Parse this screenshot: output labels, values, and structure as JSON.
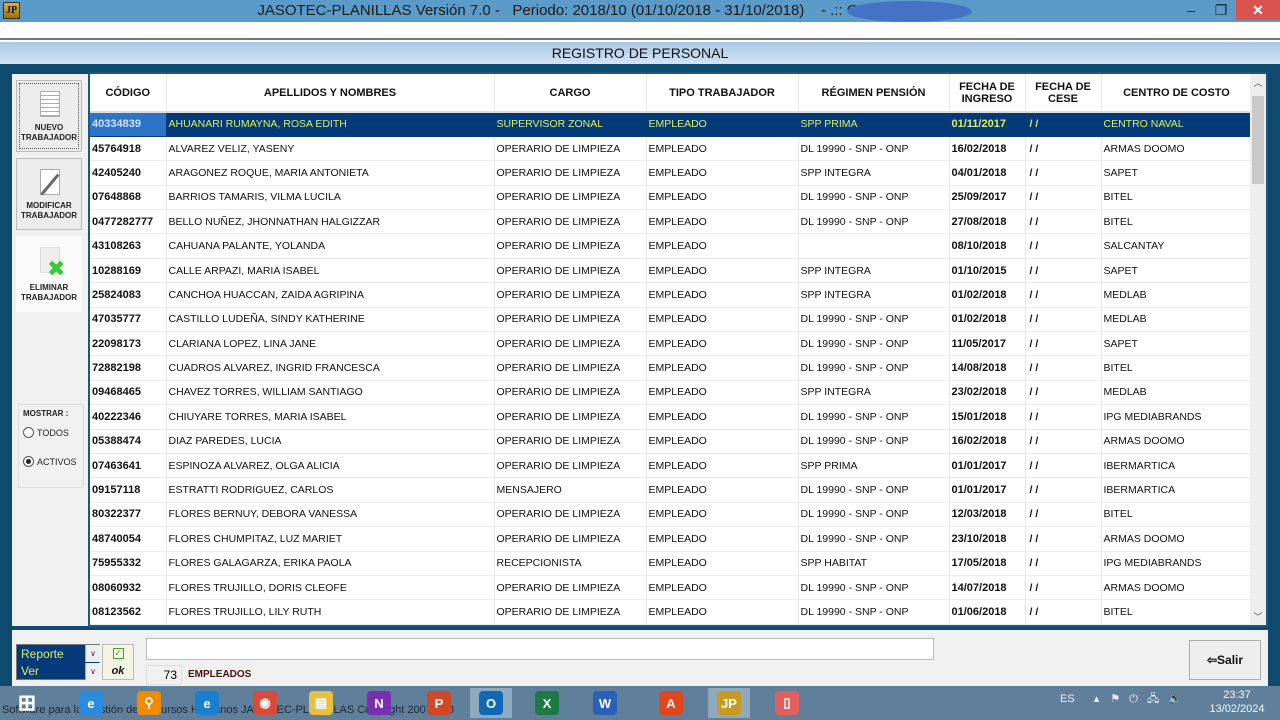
{
  "window": {
    "app_icon_label": "JP",
    "title": "JASOTEC-PLANILLAS Versión 7.0 -   Periodo: 2018/10 (01/10/2018 - 31/10/2018)    - .:: G                      :: ",
    "min_icon": "minimize-icon",
    "max_icon": "restore-icon",
    "close_glyph": "✕"
  },
  "form_title": "REGISTRO DE PERSONAL",
  "sidebar": {
    "nuevo": "NUEVO TRABAJADOR",
    "modificar": "MODIFICAR TRABAJADOR",
    "eliminar": "ELIMINAR TRABAJADOR",
    "mostrar_label": "MOSTRAR :",
    "options": [
      {
        "label": "TODOS",
        "selected": false
      },
      {
        "label": "ACTIVOS",
        "selected": true
      }
    ]
  },
  "table": {
    "columns": [
      "CÓDIGO",
      "APELLIDOS Y NOMBRES",
      "CARGO",
      "TIPO TRABAJADOR",
      "RÉGIMEN PENSIÓN",
      "FECHA DE INGRESO",
      "FECHA DE CESE",
      "CENTRO DE  COSTO"
    ],
    "selected_index": 0,
    "rows": [
      [
        "40334839",
        "AHUANARI  RUMAYNA, ROSA EDITH",
        "SUPERVISOR ZONAL",
        "EMPLEADO",
        "SPP PRIMA",
        "01/11/2017",
        "/  /",
        "CENTRO NAVAL"
      ],
      [
        "45764918",
        "ALVAREZ  VELIZ, YASENY",
        "OPERARIO DE LIMPIEZA",
        "EMPLEADO",
        "DL 19990 - SNP - ONP",
        "16/02/2018",
        "/  /",
        "ARMAS DOOMO"
      ],
      [
        "42405240",
        "ARAGONEZ  ROQUE, MARIA ANTONIETA",
        "OPERARIO DE LIMPIEZA",
        "EMPLEADO",
        "SPP INTEGRA",
        "04/01/2018",
        "/  /",
        "SAPET"
      ],
      [
        "07648868",
        "BARRIOS  TAMARIS, VILMA LUCILA",
        "OPERARIO DE LIMPIEZA",
        "EMPLEADO",
        "DL 19990 - SNP - ONP",
        "25/09/2017",
        "/  /",
        "BITEL"
      ],
      [
        "0477282777",
        "BELLO  NUÑEZ, JHONNATHAN HALGIZZAR",
        "OPERARIO DE LIMPIEZA",
        "EMPLEADO",
        "DL 19990 - SNP - ONP",
        "27/08/2018",
        "/  /",
        "BITEL"
      ],
      [
        "43108263",
        "CAHUANA  PALANTE, YOLANDA",
        "OPERARIO DE LIMPIEZA",
        "EMPLEADO",
        "",
        "08/10/2018",
        "/  /",
        "SALCANTAY"
      ],
      [
        "10288169",
        "CALLE  ARPAZI, MARIA ISABEL",
        "OPERARIO DE LIMPIEZA",
        "EMPLEADO",
        "SPP INTEGRA",
        "01/10/2015",
        "/  /",
        "SAPET"
      ],
      [
        "25824083",
        "CANCHOA  HUACCAN, ZAIDA AGRIPINA",
        "OPERARIO DE LIMPIEZA",
        "EMPLEADO",
        "SPP INTEGRA",
        "01/02/2018",
        "/  /",
        "MEDLAB"
      ],
      [
        "47035777",
        "CASTILLO  LUDEÑA, SINDY KATHERINE",
        "OPERARIO DE LIMPIEZA",
        "EMPLEADO",
        "DL 19990 - SNP - ONP",
        "01/02/2018",
        "/  /",
        "MEDLAB"
      ],
      [
        "22098173",
        "CLARIANA  LOPEZ, LINA JANE",
        "OPERARIO DE LIMPIEZA",
        "EMPLEADO",
        "DL 19990 - SNP - ONP",
        "11/05/2017",
        "/  /",
        "SAPET"
      ],
      [
        "72882198",
        "CUADROS  ALVAREZ, INGRID FRANCESCA",
        "OPERARIO DE LIMPIEZA",
        "EMPLEADO",
        "DL 19990 - SNP - ONP",
        "14/08/2018",
        "/  /",
        "BITEL"
      ],
      [
        "09468465",
        "CHAVEZ  TORRES, WILLIAM SANTIAGO",
        "OPERARIO DE LIMPIEZA",
        "EMPLEADO",
        "SPP INTEGRA",
        "23/02/2018",
        "/  /",
        "MEDLAB"
      ],
      [
        "40222346",
        "CHIUYARE  TORRES, MARIA ISABEL",
        "OPERARIO DE LIMPIEZA",
        "EMPLEADO",
        "DL 19990 - SNP - ONP",
        "15/01/2018",
        "/  /",
        "IPG MEDIABRANDS"
      ],
      [
        "05388474",
        "DIAZ  PAREDES, LUCIA",
        "OPERARIO DE LIMPIEZA",
        "EMPLEADO",
        "DL 19990 - SNP - ONP",
        "16/02/2018",
        "/  /",
        "ARMAS DOOMO"
      ],
      [
        "07463641",
        "ESPINOZA  ALVAREZ, OLGA ALICIA",
        "OPERARIO DE LIMPIEZA",
        "EMPLEADO",
        "SPP PRIMA",
        "01/01/2017",
        "/  /",
        "IBERMARTICA"
      ],
      [
        "09157118",
        "ESTRATTI  RODRIGUEZ, CARLOS",
        "MENSAJERO",
        "EMPLEADO",
        "DL 19990 - SNP - ONP",
        "01/01/2017",
        "/  /",
        "IBERMARTICA"
      ],
      [
        "80322377",
        "FLORES  BERNUY, DEBORA VANESSA",
        "OPERARIO DE LIMPIEZA",
        "EMPLEADO",
        "DL 19990 - SNP - ONP",
        "12/03/2018",
        "/  /",
        "BITEL"
      ],
      [
        "48740054",
        "FLORES  CHUMPITAZ, LUZ MARIET",
        "OPERARIO DE LIMPIEZA",
        "EMPLEADO",
        "DL 19990 - SNP - ONP",
        "23/10/2018",
        "/  /",
        "ARMAS DOOMO"
      ],
      [
        "75955332",
        "FLORES  GALAGARZA, ERIKA PAOLA",
        "RECEPCIONISTA",
        "EMPLEADO",
        "SPP HABITAT",
        "17/05/2018",
        "/  /",
        "IPG MEDIABRANDS"
      ],
      [
        "08060932",
        "FLORES  TRUJILLO, DORIS CLEOFE",
        "OPERARIO DE LIMPIEZA",
        "EMPLEADO",
        "DL 19990 - SNP - ONP",
        "14/07/2018",
        "/  /",
        "ARMAS DOOMO"
      ],
      [
        "08123562",
        "FLORES  TRUJILLO, LILY RUTH",
        "OPERARIO DE LIMPIEZA",
        "EMPLEADO",
        "DL 19990 - SNP - ONP",
        "01/06/2018",
        "/  /",
        "BITEL"
      ]
    ]
  },
  "bottom": {
    "report_options": [
      "Reporte",
      "Ver"
    ],
    "ok_label": "ok",
    "message": "",
    "count": "73",
    "count_label": "EMPLEADOS",
    "salir_label": "Salir"
  },
  "taskbar": {
    "status_text": "Software para la Gestión de Recursos Humanos   JASOTEC-PLANILLAS   Copyright 2007 - 20",
    "apps": [
      {
        "name": "start",
        "glyph": "⊞",
        "color": "#ffffff"
      },
      {
        "name": "internet-explorer",
        "glyph": "e",
        "color": "#2a8ce0"
      },
      {
        "name": "search-app",
        "glyph": "⚲",
        "color": "#f08a00"
      },
      {
        "name": "edge",
        "glyph": "e",
        "color": "#1a7fd0"
      },
      {
        "name": "chrome",
        "glyph": "◉",
        "color": "#d94a38"
      },
      {
        "name": "file-explorer",
        "glyph": "▤",
        "color": "#e8c040"
      },
      {
        "name": "onenote",
        "glyph": "N",
        "color": "#7a2fb0"
      },
      {
        "name": "powerpoint",
        "glyph": "P",
        "color": "#d24726"
      },
      {
        "name": "outlook",
        "glyph": "O",
        "color": "#1268b8"
      },
      {
        "name": "excel",
        "glyph": "X",
        "color": "#1d7a44"
      },
      {
        "name": "word",
        "glyph": "W",
        "color": "#2b5fb8"
      },
      {
        "name": "acrobat",
        "glyph": "A",
        "color": "#e2461d"
      },
      {
        "name": "jasotec",
        "glyph": "JP",
        "color": "#c89a20"
      },
      {
        "name": "phone-link",
        "glyph": "▯",
        "color": "#e06060"
      }
    ],
    "language": "ES",
    "time": "23:37",
    "date": "13/02/2024"
  }
}
